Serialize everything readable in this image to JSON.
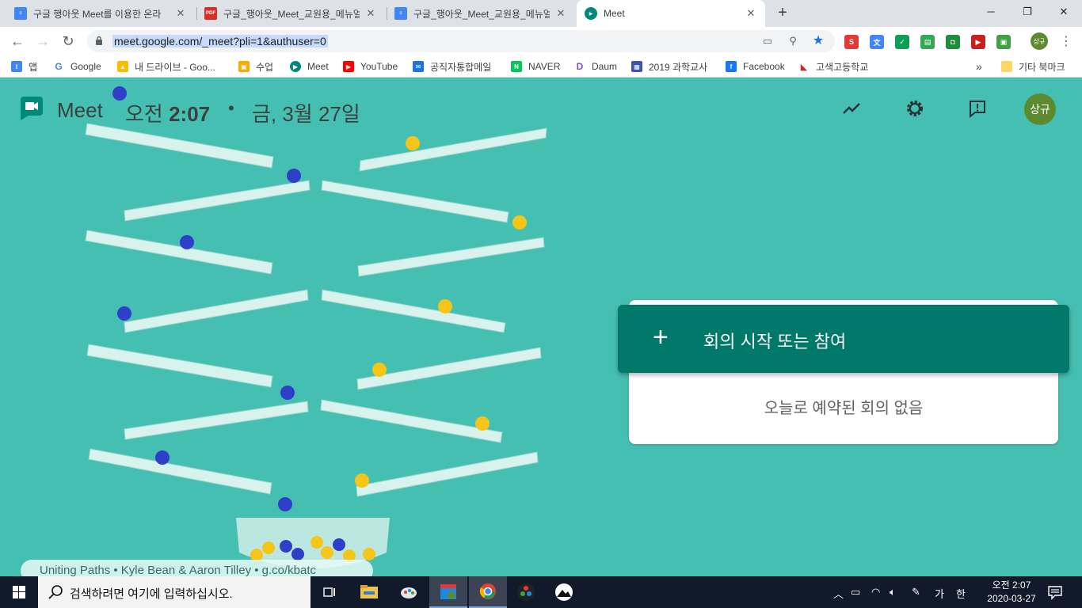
{
  "browser": {
    "tabs": [
      {
        "title": "구글 행아웃 Meet를 이용한 온라",
        "icon": "docs-icon"
      },
      {
        "title": "구글_행아웃_Meet_교원용_메뉴얼",
        "icon": "pdf-icon"
      },
      {
        "title": "구글_행아웃_Meet_교원용_메뉴얼",
        "icon": "docs-icon"
      },
      {
        "title": "Meet",
        "icon": "meet-icon",
        "active": true
      }
    ],
    "url": "meet.google.com/_meet?pli=1&authuser=0",
    "profile_chip": "상규",
    "bookmarks": [
      {
        "label": "앱",
        "icon": "apps-icon"
      },
      {
        "label": "Google",
        "icon": "google-icon"
      },
      {
        "label": "내 드라이브 - Goo...",
        "icon": "drive-icon"
      },
      {
        "label": "수업",
        "icon": "classroom-icon"
      },
      {
        "label": "Meet",
        "icon": "meet-icon"
      },
      {
        "label": "YouTube",
        "icon": "youtube-icon"
      },
      {
        "label": "공직자통합메일",
        "icon": "mail-icon"
      },
      {
        "label": "NAVER",
        "icon": "naver-icon"
      },
      {
        "label": "Daum",
        "icon": "daum-icon"
      },
      {
        "label": "2019 과학교사",
        "icon": "forms-icon"
      },
      {
        "label": "Facebook",
        "icon": "facebook-icon"
      },
      {
        "label": "고색고등학교",
        "icon": "school-icon"
      }
    ],
    "bookmarks_more": "»",
    "other_bookmarks": "기타 북마크"
  },
  "meet": {
    "app_name": "Meet",
    "time_prefix": "오전",
    "time": "2:07",
    "separator": "•",
    "date": "금, 3월 27일",
    "avatar_text": "상규",
    "join_button": "회의 시작 또는 참여",
    "join_plus": "+",
    "no_meetings": "오늘로 예약된 회의 없음",
    "credit": "Uniting Paths  •  Kyle Bean & Aaron Tilley  •  g.co/kbatc",
    "background_color": "#45bfb1",
    "accent_color": "#00796b"
  },
  "taskbar": {
    "search_placeholder": "검색하려면 여기에 입력하십시오.",
    "ime": "가",
    "ime_mode": "한",
    "time": "오전 2:07",
    "date": "2020-03-27"
  }
}
